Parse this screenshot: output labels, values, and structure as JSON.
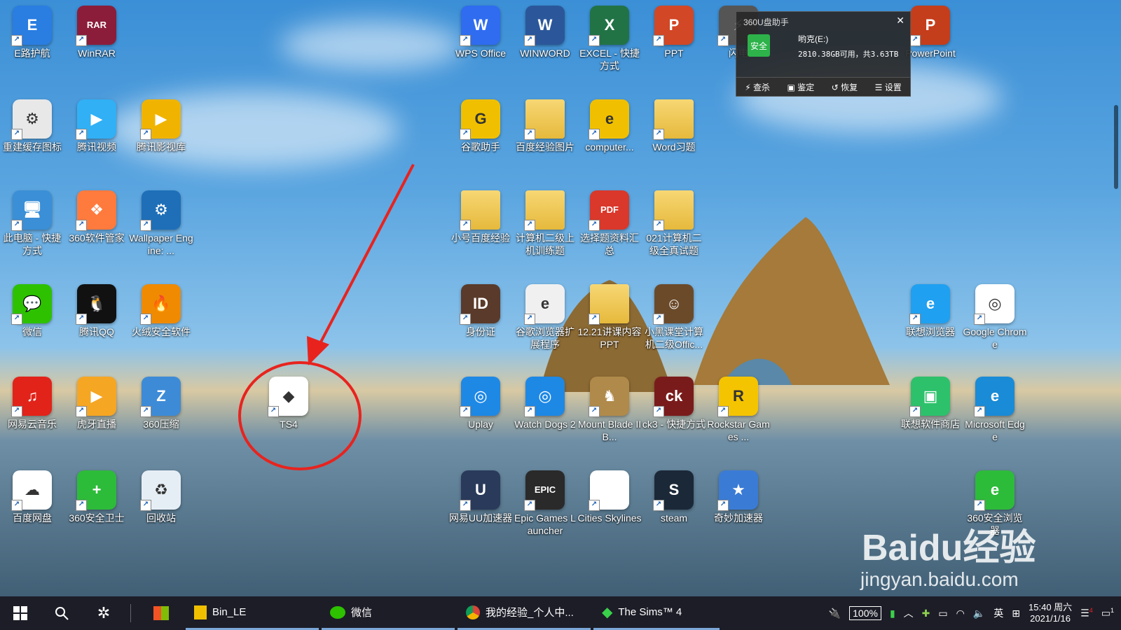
{
  "desktop": {
    "icons": [
      {
        "label": "E路护航",
        "color": "#2a7de1",
        "glyph": "E"
      },
      {
        "label": "WinRAR",
        "color": "#8b1d3a",
        "glyph": "RAR"
      },
      {
        "label": "WPS Office",
        "color": "#2f6cf0",
        "glyph": "W"
      },
      {
        "label": "WINWORD",
        "color": "#2b579a",
        "glyph": "W"
      },
      {
        "label": "EXCEL - 快捷方式",
        "color": "#217346",
        "glyph": "X"
      },
      {
        "label": "PPT",
        "color": "#d24726",
        "glyph": "P"
      },
      {
        "label": "闪电",
        "color": "#555555",
        "glyph": "⚡"
      },
      {
        "label": "PowerPoint",
        "color": "#c43e1c",
        "glyph": "P"
      },
      {
        "label": "重建缓存图标",
        "color": "#e8e8e8",
        "glyph": "⚙"
      },
      {
        "label": "腾讯视频",
        "color": "#31b0f5",
        "glyph": "▶"
      },
      {
        "label": "腾讯影视库",
        "color": "#f0b400",
        "glyph": "▶"
      },
      {
        "label": "谷歌助手",
        "color": "#f0c000",
        "glyph": "G"
      },
      {
        "label": "百度经验图片",
        "color": "#f0c000",
        "glyph": ""
      },
      {
        "label": "computer...",
        "color": "#f0c000",
        "glyph": "e"
      },
      {
        "label": "Word习题",
        "color": "#f0c000",
        "glyph": ""
      },
      {
        "label": "此电脑 - 快捷方式",
        "color": "#3b8fd6",
        "glyph": "🖥"
      },
      {
        "label": "360软件管家",
        "color": "#ff7a3d",
        "glyph": "❖"
      },
      {
        "label": "Wallpaper Engine: ...",
        "color": "#1e6fb8",
        "glyph": "⚙"
      },
      {
        "label": "小号百度经验",
        "color": "#f0c000",
        "glyph": ""
      },
      {
        "label": "计算机二级上机训练题",
        "color": "#f0c000",
        "glyph": ""
      },
      {
        "label": "选择题资料汇总",
        "color": "#d9382b",
        "glyph": "PDF"
      },
      {
        "label": "021计算机二级全真试题",
        "color": "#f0c000",
        "glyph": ""
      },
      {
        "label": "微信",
        "color": "#2dc100",
        "glyph": "💬"
      },
      {
        "label": "腾讯QQ",
        "color": "#111111",
        "glyph": "🐧"
      },
      {
        "label": "火绒安全软件",
        "color": "#f08a00",
        "glyph": "🔥"
      },
      {
        "label": "身份证",
        "color": "#5a3a2a",
        "glyph": "ID"
      },
      {
        "label": "谷歌浏览器扩展程序",
        "color": "#f0f0f0",
        "glyph": "e"
      },
      {
        "label": "12.21讲课内容PPT",
        "color": "#f0c000",
        "glyph": ""
      },
      {
        "label": "小黑课堂计算机二级Offic...",
        "color": "#6b4a2a",
        "glyph": "☺"
      },
      {
        "label": "联想浏览器",
        "color": "#1fa0f0",
        "glyph": "e"
      },
      {
        "label": "Google Chrome",
        "color": "#ffffff",
        "glyph": "◎"
      },
      {
        "label": "网易云音乐",
        "color": "#e2231a",
        "glyph": "♫"
      },
      {
        "label": "虎牙直播",
        "color": "#f5a623",
        "glyph": "▶"
      },
      {
        "label": "360压缩",
        "color": "#3d8bd6",
        "glyph": "Z"
      },
      {
        "label": "TS4",
        "color": "#ffffff",
        "glyph": "◆"
      },
      {
        "label": "Uplay",
        "color": "#1e88e5",
        "glyph": "◎"
      },
      {
        "label": "Watch Dogs 2",
        "color": "#1e88e5",
        "glyph": "◎"
      },
      {
        "label": "Mount Blade II B...",
        "color": "#b08a4a",
        "glyph": "♞"
      },
      {
        "label": "ck3 - 快捷方式",
        "color": "#7a1b1b",
        "glyph": "ck"
      },
      {
        "label": "Rockstar Games ...",
        "color": "#f5c400",
        "glyph": "R"
      },
      {
        "label": "联想软件商店",
        "color": "#2dc16b",
        "glyph": "▣"
      },
      {
        "label": "Microsoft Edge",
        "color": "#1a8bd6",
        "glyph": "e"
      },
      {
        "label": "百度网盘",
        "color": "#ffffff",
        "glyph": "☁"
      },
      {
        "label": "360安全卫士",
        "color": "#2dbb3a",
        "glyph": "+"
      },
      {
        "label": "回收站",
        "color": "#e6eef5",
        "glyph": "♻"
      },
      {
        "label": "网易UU加速器",
        "color": "#2a3a5a",
        "glyph": "U"
      },
      {
        "label": "Epic Games Launcher",
        "color": "#2a2a2a",
        "glyph": "EPIC"
      },
      {
        "label": "Cities Skylines",
        "color": "#ffffff",
        "glyph": ""
      },
      {
        "label": "steam",
        "color": "#1b2838",
        "glyph": "S"
      },
      {
        "label": "奇妙加速器",
        "color": "#3a7bd5",
        "glyph": "★"
      },
      {
        "label": "360安全浏览器",
        "color": "#2dbb3a",
        "glyph": "e"
      }
    ]
  },
  "popup": {
    "title": "360U盘助手",
    "safe_label": "安全",
    "drive": "哟克(E:)",
    "space": "2810.38GB可用，共3.63TB",
    "actions": [
      "查杀",
      "鉴定",
      "恢复",
      "设置"
    ]
  },
  "taskbar": {
    "apps": [
      {
        "label": "Bin_LE",
        "icon": "folder-icon"
      },
      {
        "label": "微信",
        "icon": "wechat-icon"
      },
      {
        "label": "我的经验_个人中...",
        "icon": "chrome-icon"
      },
      {
        "label": "The Sims™ 4",
        "icon": "sims-icon"
      }
    ],
    "battery": "100%",
    "ime": "英",
    "time": "15:40 周六",
    "date": "2021/1/16",
    "notif_count": "1",
    "tray_badge": "4"
  },
  "watermark": {
    "text": "Baidu经验",
    "url": "jingyan.baidu.com"
  }
}
